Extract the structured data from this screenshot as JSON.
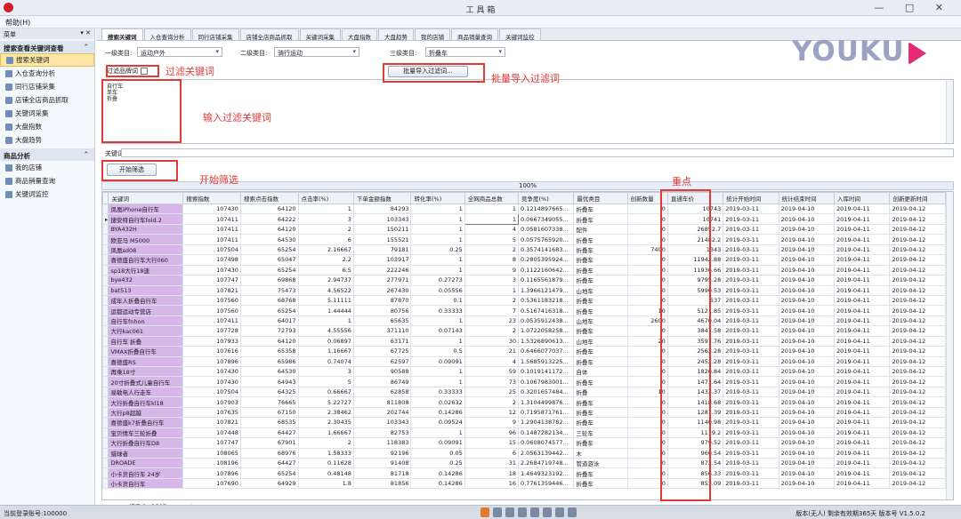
{
  "window": {
    "title": "工 具 箱",
    "controls": "— □ ✕"
  },
  "menubar": {
    "item": "帮助(H)"
  },
  "sidebar": {
    "header": "菜单",
    "pin": "▾ ✕",
    "groups": [
      {
        "label": "搜索查看关键词查看",
        "items": [
          {
            "label": "搜索关键词",
            "active": true
          },
          {
            "label": "入仓查询分析"
          },
          {
            "label": "同行店铺采集"
          },
          {
            "label": "店铺全店商品抓取"
          },
          {
            "label": "关键词采集"
          },
          {
            "label": "大盘指数"
          },
          {
            "label": "大盘趋势"
          }
        ]
      },
      {
        "label": "商品分析",
        "items": [
          {
            "label": "我的店铺"
          },
          {
            "label": "商品销量查询"
          },
          {
            "label": "关键词监控"
          }
        ]
      }
    ]
  },
  "tabs": [
    "搜索关键词",
    "入仓查询分析",
    "同行店铺采集",
    "店铺全店商品抓取",
    "关键词采集",
    "大盘指数",
    "大盘趋势",
    "我的店铺",
    "商品销量查询",
    "关键词监控"
  ],
  "filters": {
    "cat1_label": "一级类目:",
    "cat1_value": "运动户外",
    "cat2_label": "二级类目:",
    "cat2_value": "骑行运动",
    "cat3_label": "三级类目:",
    "cat3_value": "折叠车"
  },
  "logo": {
    "text": "YOUKU"
  },
  "filter_keyword": {
    "label": "过滤品牌词"
  },
  "import_button": {
    "label": "批量导入过滤词..."
  },
  "keyword_lines": [
    "自行车",
    "单车",
    "折叠"
  ],
  "keyword_input": {
    "label": "关键词:"
  },
  "start_button": {
    "label": "开始筛选"
  },
  "progress": {
    "text": "100%",
    "value": 100
  },
  "table": {
    "columns": [
      "关键词",
      "搜索指数",
      "搜索点击指数",
      "点击率(%)",
      "下单金额指数",
      "转化率(%)",
      "全网商品总数",
      "竞争度(%)",
      "最优类目",
      "创新数量",
      "直通车价",
      "统计开始时间",
      "统计结束时间",
      "入库时间",
      "创新更新时间"
    ],
    "rows": [
      [
        "凤凰iPhone自行车",
        "107430",
        "64120",
        "1",
        "84293",
        "1",
        "1",
        "0.1214897665…",
        "折叠车",
        "0",
        "10743",
        "2019-03-11",
        "2019-04-10",
        "2019-04-11",
        "2019-04-12"
      ],
      [
        "捷安特自行车fold.2",
        "107411",
        "64222",
        "3",
        "103343",
        "1",
        "1",
        "0.0667349055…",
        "折叠车",
        "0",
        "10741",
        "2019-03-11",
        "2019-04-10",
        "2019-04-11",
        "2019-04-12"
      ],
      [
        "BYA432H",
        "107411",
        "64120",
        "2",
        "150211",
        "1",
        "4",
        "0.0581607338…",
        "配件",
        "0",
        "26852.7",
        "2019-03-11",
        "2019-04-10",
        "2019-04-11",
        "2019-04-12"
      ],
      [
        "欧亚马 M5000",
        "107411",
        "64530",
        "6",
        "155521",
        "1",
        "5",
        "0.0575765920…",
        "折叠车",
        "0",
        "21482.2",
        "2019-03-11",
        "2019-04-10",
        "2019-04-11",
        "2019-04-12"
      ],
      [
        "凤凰sd08",
        "107504",
        "65254",
        "2.16667",
        "79181",
        "0.25",
        "2",
        "0.3574141683…",
        "折叠车",
        "7400",
        "1343",
        "2019-03-11",
        "2019-04-10",
        "2019-04-11",
        "2019-04-12"
      ],
      [
        "喜德盛自行车大行060",
        "107498",
        "65047",
        "2.2",
        "103917",
        "1",
        "8",
        "0.2805395924…",
        "折叠车",
        "0",
        "11942.88",
        "2019-03-11",
        "2019-04-10",
        "2019-04-11",
        "2019-04-12"
      ],
      [
        "sp18大行18速",
        "107430",
        "65254",
        "6.5",
        "222246",
        "1",
        "9",
        "0.1122160642…",
        "折叠车",
        "0",
        "11936.66",
        "2019-03-11",
        "2019-04-10",
        "2019-04-11",
        "2019-04-12"
      ],
      [
        "bye432",
        "107747",
        "69868",
        "2.94737",
        "277971",
        "0.27273",
        "3",
        "0.1165561879…",
        "折叠车",
        "0",
        "9795.28",
        "2019-03-11",
        "2019-04-10",
        "2019-04-11",
        "2019-04-12"
      ],
      [
        "bat513",
        "107821",
        "75473",
        "4.56522",
        "267430",
        "0.05556",
        "1",
        "1.3966121479…",
        "山地车",
        "0",
        "5990.53",
        "2019-03-11",
        "2019-04-10",
        "2019-04-11",
        "2019-04-12"
      ],
      [
        "成年人折叠自行车",
        "107560",
        "68768",
        "5.11111",
        "87870",
        "0.1",
        "2",
        "0.5361183218…",
        "折叠车",
        "0",
        "537",
        "2019-03-11",
        "2019-04-10",
        "2019-04-11",
        "2019-04-12"
      ],
      [
        "运都运动专营店",
        "107560",
        "65254",
        "1.44444",
        "80756",
        "0.33333",
        "7",
        "0.5167416318…",
        "折叠车",
        "10",
        "5121.85",
        "2019-03-11",
        "2019-04-10",
        "2019-04-11",
        "2019-04-12"
      ],
      [
        "自行车fnhon",
        "107411",
        "64017",
        "1",
        "65635",
        "1",
        "23",
        "0.0535912438…",
        "山地车",
        "2600",
        "4670.04",
        "2019-03-11",
        "2019-04-10",
        "2019-04-11",
        "2019-04-12"
      ],
      [
        "大行kac061",
        "107728",
        "72793",
        "4.55556",
        "371110",
        "0.07143",
        "2",
        "1.0722058258…",
        "折叠车",
        "0",
        "3847.58",
        "2019-03-11",
        "2019-04-10",
        "2019-04-11",
        "2019-04-12"
      ],
      [
        "自行车 折叠",
        "107933",
        "64120",
        "0.06897",
        "63171",
        "1",
        "30",
        "1.5326890613…",
        "山地车",
        "20",
        "3597.76",
        "2019-03-11",
        "2019-04-10",
        "2019-04-11",
        "2019-04-12"
      ],
      [
        "VMAX折叠自行车",
        "107616",
        "65358",
        "1.16667",
        "67725",
        "0.5",
        "21",
        "0.6466077037…",
        "折叠车",
        "0",
        "2562.28",
        "2019-03-11",
        "2019-04-10",
        "2019-04-11",
        "2019-04-12"
      ],
      [
        "喜德盛RS",
        "107896",
        "65986",
        "0.74074",
        "62597",
        "0.09091",
        "4",
        "1.5685913225…",
        "折叠车",
        "0",
        "2452.28",
        "2019-03-11",
        "2019-04-10",
        "2019-04-11",
        "2019-04-12"
      ],
      [
        "再乘18寸",
        "107430",
        "64530",
        "3",
        "90588",
        "1",
        "59",
        "0.1019141172…",
        "自体",
        "0",
        "1820.84",
        "2019-03-11",
        "2019-04-10",
        "2019-04-11",
        "2019-04-12"
      ],
      [
        "20寸折叠式儿童自行车",
        "107430",
        "64943",
        "5",
        "86749",
        "1",
        "73",
        "0.1067983001…",
        "折叠车",
        "0",
        "1471.64",
        "2019-03-11",
        "2019-04-10",
        "2019-04-11",
        "2019-04-12"
      ],
      [
        "易敏电人行走车",
        "107504",
        "64325",
        "0.66667",
        "62858",
        "0.33333",
        "25",
        "0.3201657484…",
        "折叠",
        "10",
        "1433.37",
        "2019-03-11",
        "2019-04-10",
        "2019-04-11",
        "2019-04-12"
      ],
      [
        "大行折叠自行车kl18",
        "107903",
        "76665",
        "5.22727",
        "811808",
        "0.02632",
        "2",
        "1.3104499876…",
        "折叠车",
        "0",
        "1418.68",
        "2019-03-11",
        "2019-04-10",
        "2019-04-11",
        "2019-04-12"
      ],
      [
        "大行p8超越",
        "107635",
        "67150",
        "2.38462",
        "202744",
        "0.14286",
        "12",
        "0.7195871761…",
        "折叠车",
        "0",
        "1281.39",
        "2019-03-11",
        "2019-04-10",
        "2019-04-11",
        "2019-04-12"
      ],
      [
        "喜德盛k7折叠自行车",
        "107821",
        "68535",
        "2.30435",
        "103343",
        "0.09524",
        "9",
        "1.2904138782…",
        "折叠车",
        "0",
        "1140.98",
        "2019-03-11",
        "2019-04-10",
        "2019-04-11",
        "2019-04-12"
      ],
      [
        "宝贝情车三轮折叠",
        "107448",
        "64427",
        "1.66667",
        "82753",
        "1",
        "96",
        "0.1487282134…",
        "三轮车",
        "0",
        "1119.2",
        "2019-03-11",
        "2019-04-10",
        "2019-04-11",
        "2019-04-12"
      ],
      [
        "大行折叠自行车D8",
        "107747",
        "67901",
        "2",
        "118383",
        "0.09091",
        "15",
        "0.0608074577…",
        "折叠车",
        "0",
        "979.52",
        "2019-03-11",
        "2019-04-10",
        "2019-04-11",
        "2019-04-12"
      ],
      [
        "猎球者",
        "108065",
        "68976",
        "1.58333",
        "92196",
        "0.05",
        "6",
        "2.0563139442…",
        "木",
        "0",
        "960.54",
        "2019-03-11",
        "2019-04-10",
        "2019-04-11",
        "2019-04-12"
      ],
      [
        "DROADE",
        "108196",
        "64427",
        "0.11628",
        "91408",
        "0.25",
        "31",
        "2.2684719748…",
        "管道游泳",
        "0",
        "872.54",
        "2019-03-11",
        "2019-04-10",
        "2019-04-11",
        "2019-04-12"
      ],
      [
        "小卡货自行车 24岁",
        "107896",
        "65254",
        "0.48148",
        "81718",
        "0.14286",
        "18",
        "1.4649323192…",
        "折叠车",
        "0",
        "856.33",
        "2019-03-11",
        "2019-04-10",
        "2019-04-11",
        "2019-04-12"
      ],
      [
        "小卡货自行车",
        "107690",
        "64929",
        "1.8",
        "81856",
        "0.14286",
        "16",
        "0.7761359446…",
        "折叠车",
        "0",
        "853.09",
        "2019-03-11",
        "2019-04-10",
        "2019-04-11",
        "2019-04-12"
      ]
    ]
  },
  "pager": {
    "text": "◀◀ ◀ 记录 2 of 397 ▶ ▶▶ ▶*"
  },
  "statusbar": {
    "left": "当前登录账号:100000",
    "right": "版本(无人) 剩余有效期365天 版本号 V1.5.0.2"
  },
  "annotations": [
    {
      "label": "过滤关键词"
    },
    {
      "label": "批量导入过滤词"
    },
    {
      "label": "输入过滤关键词"
    },
    {
      "label": "开始筛选"
    },
    {
      "label": "重点"
    }
  ],
  "colors": {
    "accent_red": "#e53935",
    "keyword_bg": "#d7b6ea",
    "active_item": "#ffe8a6",
    "logo": "#9aa3c2",
    "logo_play": "#e52b73"
  }
}
